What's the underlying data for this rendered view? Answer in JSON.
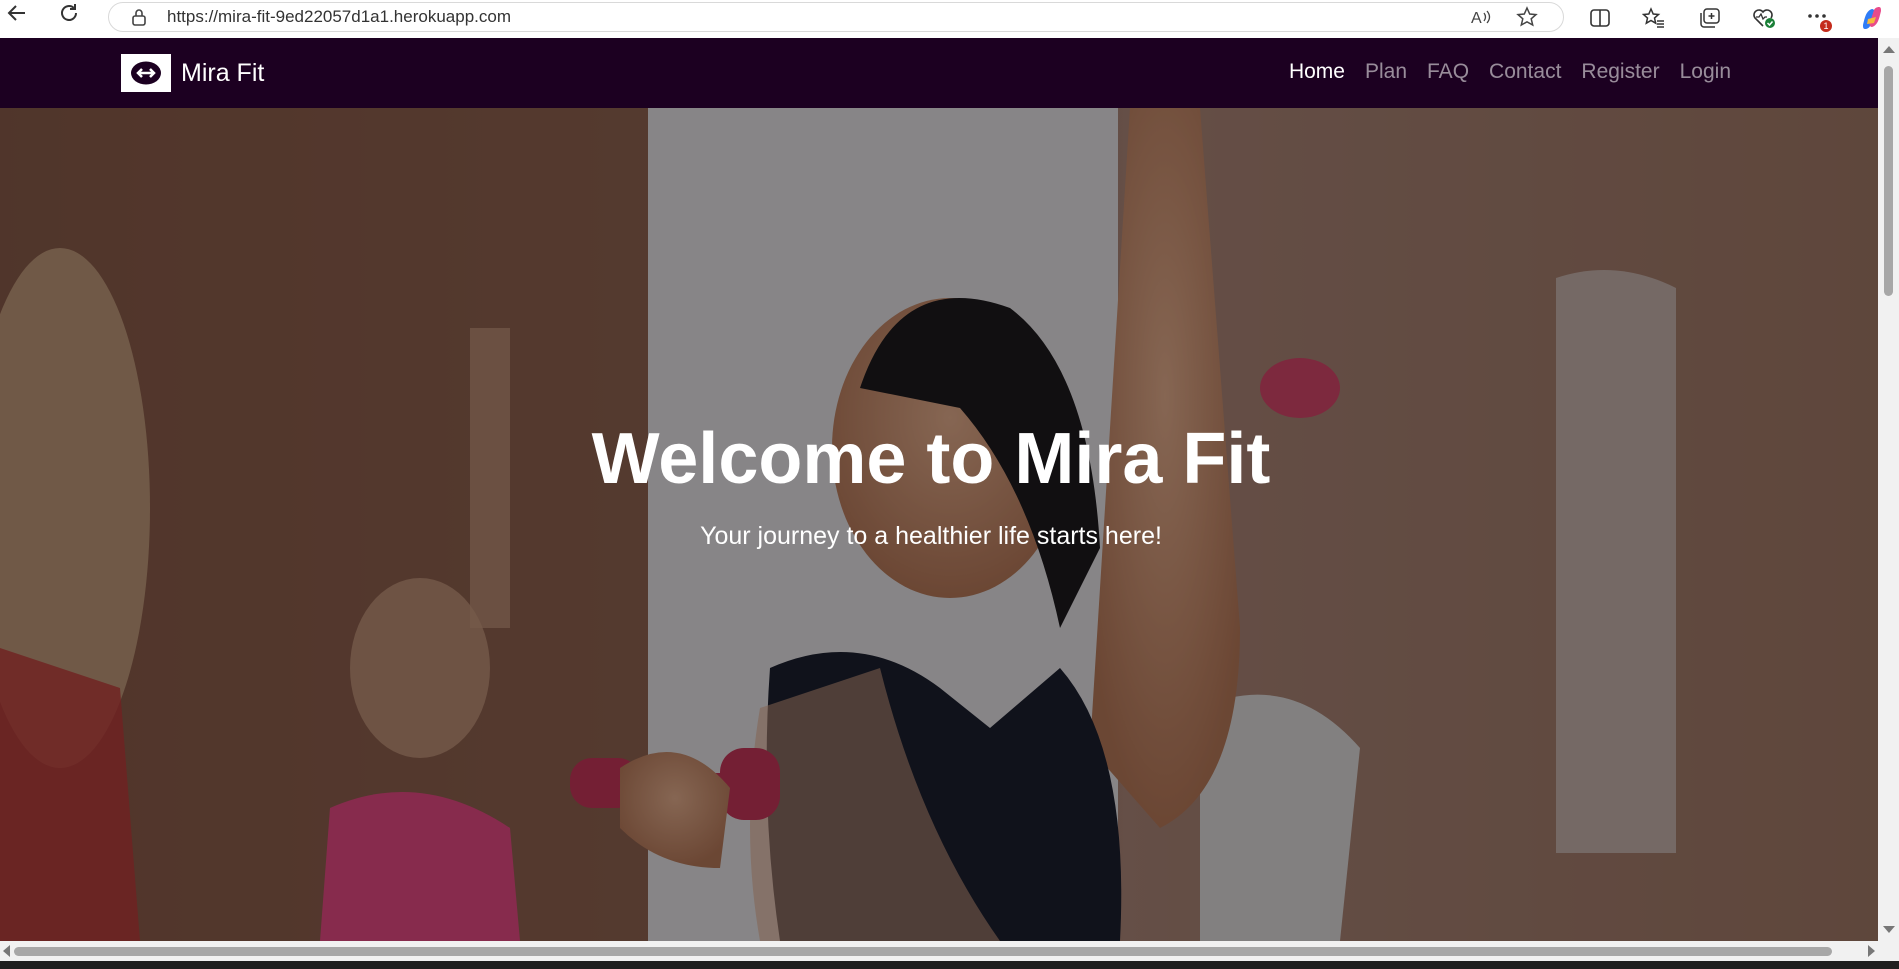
{
  "browser": {
    "url": "https://mira-fit-9ed22057d1a1.herokuapp.com",
    "notification_count": "1"
  },
  "navbar": {
    "brand_name": "Mira Fit",
    "links": [
      {
        "label": "Home",
        "active": true
      },
      {
        "label": "Plan",
        "active": false
      },
      {
        "label": "FAQ",
        "active": false
      },
      {
        "label": "Contact",
        "active": false
      },
      {
        "label": "Register",
        "active": false
      },
      {
        "label": "Login",
        "active": false
      }
    ],
    "background_color": "#1c0021"
  },
  "hero": {
    "title": "Welcome to Mira Fit",
    "subtitle": "Your journey to a healthier life starts here!"
  },
  "icons": {
    "back": "back-arrow-icon",
    "refresh": "refresh-icon",
    "lock": "lock-icon",
    "read_aloud": "read-aloud-icon",
    "favorite": "star-icon",
    "split_screen": "split-screen-icon",
    "favorites": "favorites-icon",
    "collections": "collections-icon",
    "health": "browser-essentials-icon",
    "more": "more-icon",
    "copilot": "copilot-icon",
    "logo": "dumbbell-logo-icon"
  }
}
